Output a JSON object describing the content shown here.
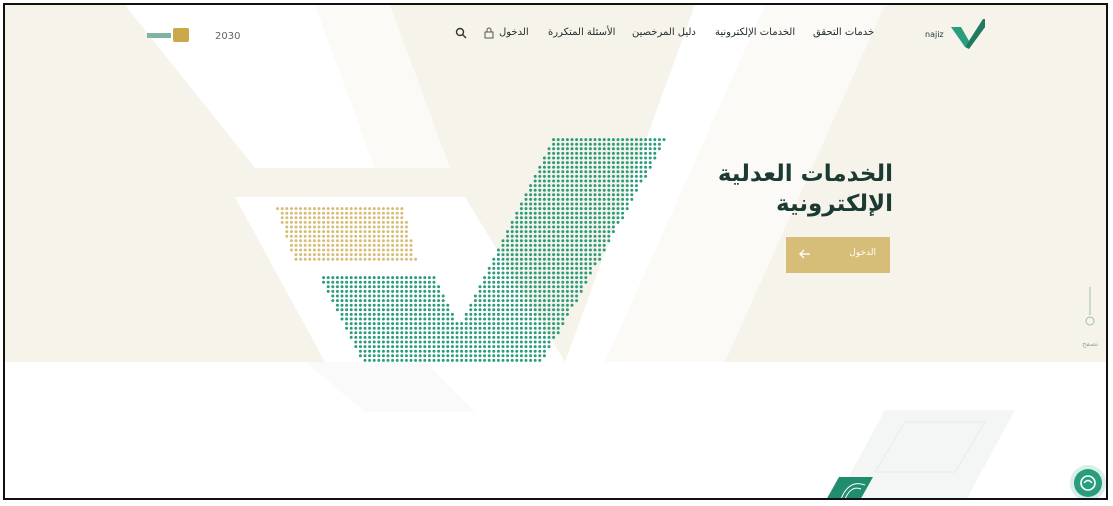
{
  "header": {
    "nav": [
      {
        "label": "خدمات التحقق"
      },
      {
        "label": "الخدمات الإلكترونية"
      },
      {
        "label": "دليل المرخصين"
      },
      {
        "label": "الأسئلة المتكررة"
      },
      {
        "label": "الدخول"
      }
    ],
    "logo_text": "ناجز najiz",
    "gov_logos_text": "2030"
  },
  "hero": {
    "title_line1": "الخدمات العدلية",
    "title_line2": "الإلكترونية",
    "login_button": "الدخول"
  },
  "side": {
    "scroll_label": "تصفح"
  },
  "icons": [
    "search-icon",
    "lock-icon",
    "arrow-left-icon",
    "chat-icon",
    "fingerprint-icon"
  ],
  "colors": {
    "primary_green": "#2a9d7c",
    "gold": "#d6bd78",
    "dark_text": "#1b3a34",
    "hero_bg": "#f6f3ea"
  }
}
